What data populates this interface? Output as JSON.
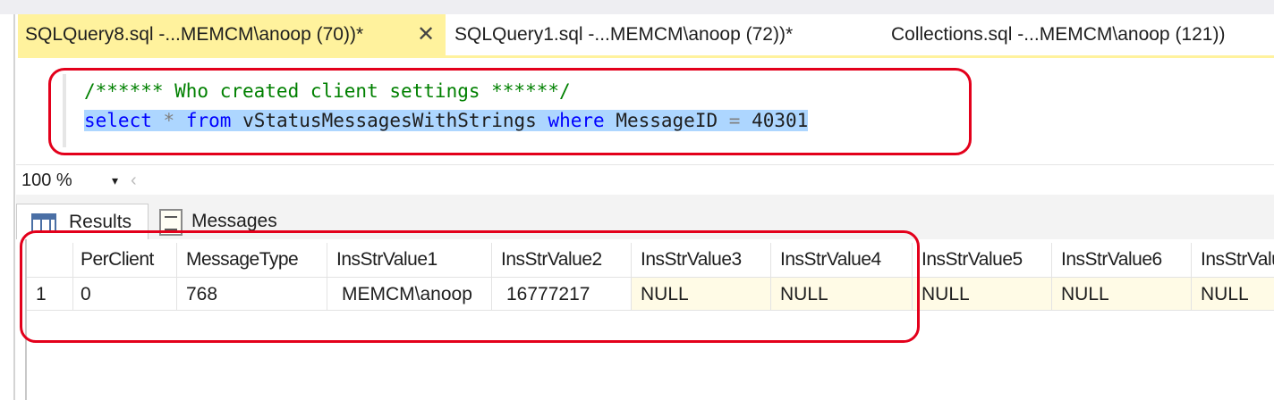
{
  "tabs": [
    {
      "label": "SQLQuery8.sql -...MEMCM\\anoop (70))*",
      "active": true,
      "close_glyph": "✕"
    },
    {
      "label": "SQLQuery1.sql -...MEMCM\\anoop (72))*",
      "active": false
    },
    {
      "label": "Collections.sql -...MEMCM\\anoop (121))",
      "active": false
    }
  ],
  "editor": {
    "comment_line": "/****** Who created client settings ******/",
    "query": {
      "kw_select": "select",
      "star": "*",
      "kw_from": "from",
      "view": "vStatusMessagesWithStrings",
      "kw_where": "where",
      "column": "MessageID",
      "equals": "=",
      "value": "40301"
    }
  },
  "zoom": {
    "value": "100 %",
    "arrow": "▾",
    "scroll_left": "‹"
  },
  "results_tabs": {
    "results": "Results",
    "messages": "Messages"
  },
  "grid": {
    "columns": [
      "PerClient",
      "MessageType",
      "InsStrValue1",
      "InsStrValue2",
      "InsStrValue3",
      "InsStrValue4",
      "InsStrValue5",
      "InsStrValue6",
      "InsStrValu"
    ],
    "rows": [
      {
        "num": "1",
        "cells": [
          "0",
          "768",
          "MEMCM\\anoop",
          "16777217",
          "NULL",
          "NULL",
          "NULL",
          "NULL",
          "NULL"
        ]
      }
    ]
  },
  "colors": {
    "active_tab": "#fff29d",
    "highlight_box": "#e3001b",
    "selection": "#add6ff",
    "keyword": "#0000ff",
    "comment": "#008000",
    "null_cell": "#fffbe6"
  }
}
